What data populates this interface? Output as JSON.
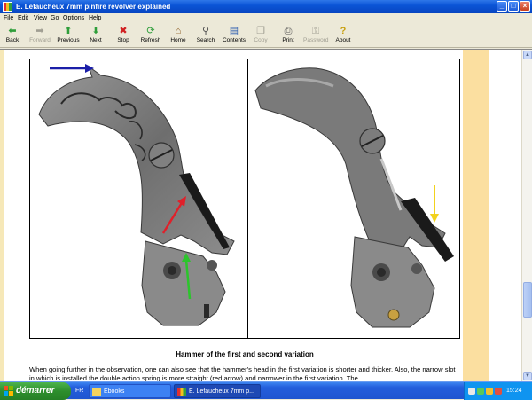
{
  "window": {
    "title": "E. Lefaucheux 7mm pinfire revolver explained",
    "controls": [
      "minimize",
      "maximize",
      "close"
    ]
  },
  "menu": [
    "File",
    "Edit",
    "View",
    "Go",
    "Options",
    "Help"
  ],
  "toolbar": [
    {
      "label": "Back",
      "icon": "back-arrow-icon",
      "enabled": true
    },
    {
      "label": "Forward",
      "icon": "forward-arrow-icon",
      "enabled": false
    },
    {
      "label": "Previous",
      "icon": "up-arrow-icon",
      "enabled": true
    },
    {
      "label": "Next",
      "icon": "down-arrow-icon",
      "enabled": true
    },
    {
      "label": "Stop",
      "icon": "stop-icon",
      "enabled": true
    },
    {
      "label": "Refresh",
      "icon": "refresh-icon",
      "enabled": true
    },
    {
      "label": "Home",
      "icon": "home-icon",
      "enabled": true
    },
    {
      "label": "Search",
      "icon": "search-icon",
      "enabled": true
    },
    {
      "label": "Contents",
      "icon": "contents-icon",
      "enabled": true
    },
    {
      "label": "Copy",
      "icon": "copy-icon",
      "enabled": false
    },
    {
      "label": "Print",
      "icon": "print-icon",
      "enabled": true
    },
    {
      "label": "Password",
      "icon": "key-icon",
      "enabled": false
    },
    {
      "label": "About",
      "icon": "help-icon",
      "enabled": true
    }
  ],
  "page": {
    "image_alt_left": "hammer first variation",
    "image_alt_right": "hammer second variation",
    "caption": "Hammer of the first and second variation",
    "body": "When going further in the observation, one can also see that the hammer's head in the first variation is shorter and thicker. Also, the narrow slot in which is installed the double action spring is more straight (red arrow) and narrower in the first variation. The"
  },
  "taskbar": {
    "start_label": "démarrer",
    "language": "FR",
    "tasks": [
      {
        "label": "Ebooks",
        "icon": "folder-icon",
        "active": false
      },
      {
        "label": "E. Lefaucheux 7mm p...",
        "icon": "book-icon",
        "active": true
      }
    ],
    "clock": "15:24"
  },
  "colors": {
    "title_bar": "#0A54D6",
    "page_band": "#FBDFA0",
    "arrow_blue": "#1B1FA8",
    "arrow_red": "#E0202A",
    "arrow_green": "#2CC52C",
    "arrow_yellow": "#F2D21E"
  }
}
